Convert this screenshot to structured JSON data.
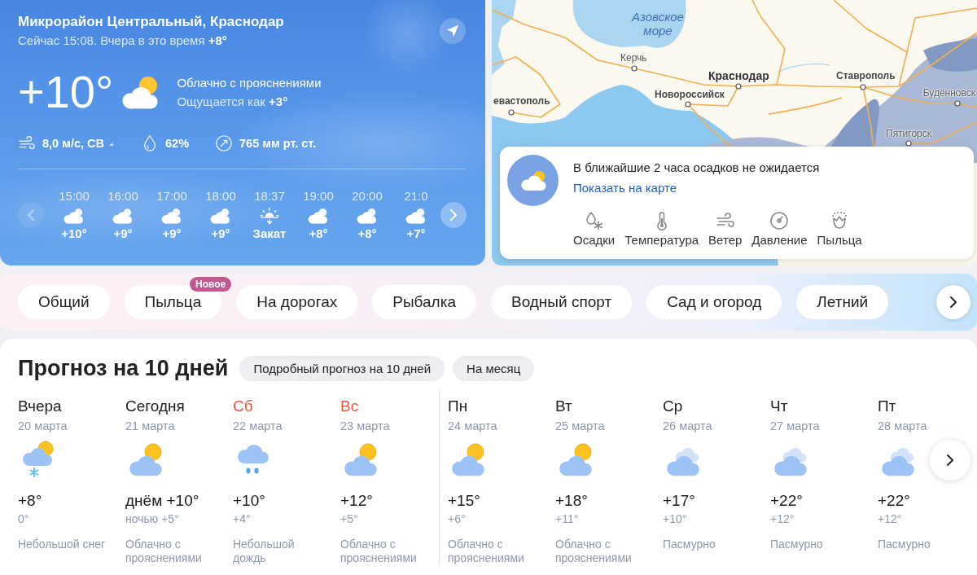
{
  "location": {
    "title": "Микрорайон Центральный, Краснодар",
    "subtitle": "Сейчас 15:08. Вчера в это время **+8°**"
  },
  "current": {
    "temperature": "+10°",
    "condition": "Облачно с прояснениями",
    "feels_like": "Ощущается как **+3°**",
    "wind": "8,0 м/с, СВ",
    "humidity": "62%",
    "pressure": "765 мм рт. ст."
  },
  "hourly": {
    "prev": {
      "disabled": true
    },
    "next": {
      "disabled": false
    },
    "items": [
      {
        "time": "15:00",
        "kind": "cloudy",
        "value": "+10°"
      },
      {
        "time": "16:00",
        "kind": "cloudy",
        "value": "+9°"
      },
      {
        "time": "17:00",
        "kind": "cloudy",
        "value": "+9°"
      },
      {
        "time": "18:00",
        "kind": "cloudy",
        "value": "+9°"
      },
      {
        "time": "18:37",
        "kind": "sunset",
        "value": "Закат"
      },
      {
        "time": "19:00",
        "kind": "cloudy",
        "value": "+8°"
      },
      {
        "time": "20:00",
        "kind": "cloudy",
        "value": "+8°"
      },
      {
        "time": "21:0",
        "kind": "cloudy",
        "value": "+7°"
      }
    ]
  },
  "map": {
    "labels": [
      {
        "text": "Азовское море",
        "kind": "sea"
      },
      {
        "text": "Керчь",
        "kind": "town"
      },
      {
        "text": "Краснодар",
        "kind": "capital"
      },
      {
        "text": "Новороссийск",
        "kind": "city"
      },
      {
        "text": "евастополь",
        "kind": "city"
      },
      {
        "text": "Ставрополь",
        "kind": "city"
      },
      {
        "text": "Будённовск",
        "kind": "town"
      },
      {
        "text": "Пятигорск",
        "kind": "town"
      }
    ],
    "panel": {
      "message": "В ближайшие 2 часа осадков не ожидается",
      "link": "Показать на карте",
      "layers": [
        {
          "label": "Осадки",
          "kind": "precipitation"
        },
        {
          "label": "Температура",
          "kind": "temperature"
        },
        {
          "label": "Ветер",
          "kind": "wind"
        },
        {
          "label": "Давление",
          "kind": "pressure"
        },
        {
          "label": "Пыльца",
          "kind": "pollen"
        }
      ]
    }
  },
  "categories": {
    "tabs": [
      {
        "label": "Общий"
      },
      {
        "label": "Пыльца",
        "badge": "Новое"
      },
      {
        "label": "На дорогах"
      },
      {
        "label": "Рыбалка"
      },
      {
        "label": "Водный спорт"
      },
      {
        "label": "Сад и огород"
      },
      {
        "label": "Летний"
      }
    ]
  },
  "forecast": {
    "title": "Прогноз на 10 дней",
    "links": [
      "Подробный прогноз на 10 дней",
      "На месяц"
    ],
    "days": [
      {
        "day": "Вчера",
        "date": "20 марта",
        "weekend": false,
        "kind": "light_snow",
        "temp_day": "+8°",
        "temp_night": "0°",
        "condition": "Небольшой снег"
      },
      {
        "day": "Сегодня",
        "date": "21 марта",
        "weekend": false,
        "kind": "partly_cloudy",
        "temp_day": "днём +10°",
        "temp_night": "ночью +5°",
        "condition": "Облачно с прояснениями"
      },
      {
        "day": "Сб",
        "date": "22 марта",
        "weekend": true,
        "kind": "light_rain",
        "temp_day": "+10°",
        "temp_night": "+4°",
        "condition": "Небольшой дождь"
      },
      {
        "day": "Вс",
        "date": "23 марта",
        "weekend": true,
        "kind": "partly_cloudy",
        "temp_day": "+12°",
        "temp_night": "+5°",
        "condition": "Облачно с прояснениями"
      },
      {
        "day": "Пн",
        "date": "24 марта",
        "weekend": false,
        "kind": "partly_cloudy",
        "temp_day": "+15°",
        "temp_night": "+6°",
        "condition": "Облачно с прояснениями"
      },
      {
        "day": "Вт",
        "date": "25 марта",
        "weekend": false,
        "kind": "partly_cloudy",
        "temp_day": "+18°",
        "temp_night": "+11°",
        "condition": "Облачно с прояснениями"
      },
      {
        "day": "Ср",
        "date": "26 марта",
        "weekend": false,
        "kind": "overcast",
        "temp_day": "+17°",
        "temp_night": "+10°",
        "condition": "Пасмурно"
      },
      {
        "day": "Чт",
        "date": "27 марта",
        "weekend": false,
        "kind": "overcast",
        "temp_day": "+22°",
        "temp_night": "+12°",
        "condition": "Пасмурно"
      },
      {
        "day": "Пт",
        "date": "28 марта",
        "weekend": false,
        "kind": "overcast",
        "temp_day": "+22°",
        "temp_night": "+12°",
        "condition": "Пасмурно"
      }
    ]
  }
}
